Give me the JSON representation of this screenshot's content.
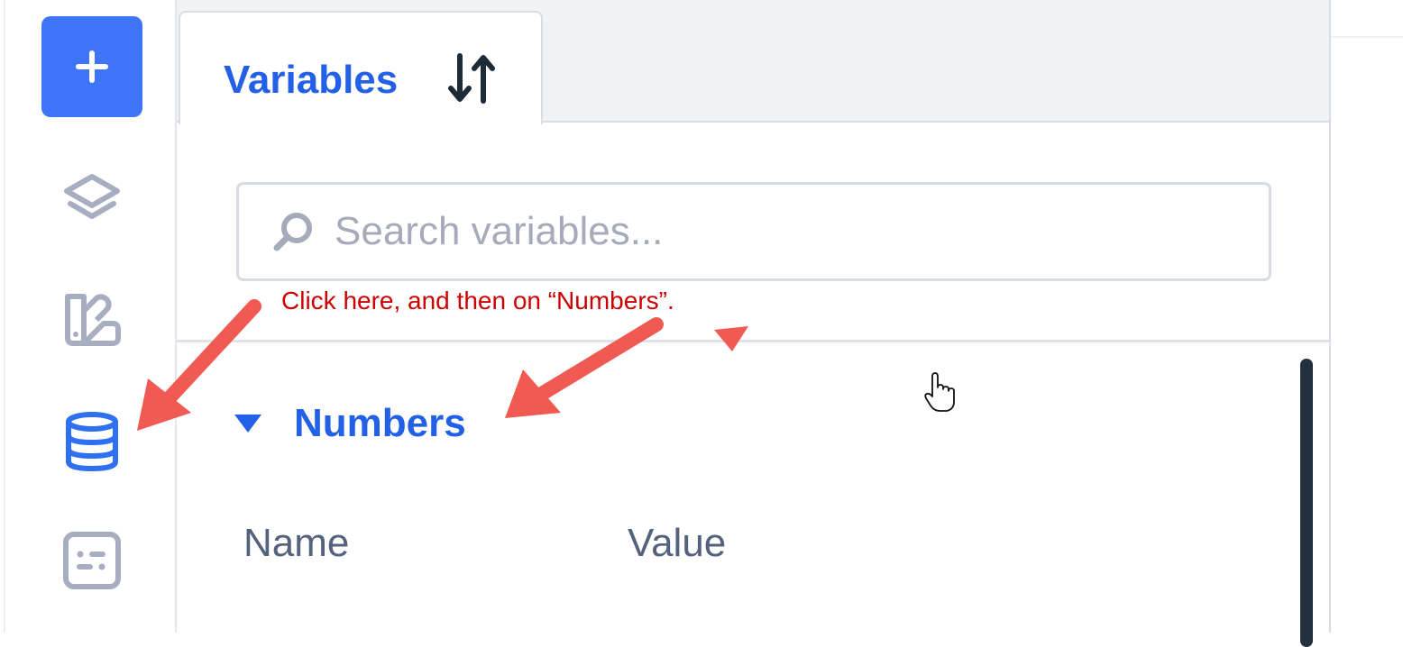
{
  "tabs": [
    {
      "label": "Variables",
      "active": true,
      "icon": "sort-icon"
    }
  ],
  "search": {
    "placeholder": "Search variables...",
    "value": "",
    "icon": "search-icon"
  },
  "group": {
    "label": "Numbers",
    "expanded": true,
    "icon": "caret-down-icon"
  },
  "table": {
    "columns": [
      "Name",
      "Value"
    ]
  },
  "sidebar": {
    "add_icon": "plus-icon",
    "items": [
      {
        "icon": "layers-icon",
        "active": false
      },
      {
        "icon": "paint-icon",
        "active": false
      },
      {
        "icon": "database-icon",
        "active": true
      },
      {
        "icon": "dialog-icon",
        "active": false
      }
    ]
  },
  "annotation": {
    "text": "Click here, and then on “Numbers”."
  },
  "colors": {
    "accent": "#3e75f7",
    "active_text": "#2360e8",
    "annotation": "#cc0000",
    "arrow": "#f05a52",
    "icon_inactive": "#a7aec1"
  }
}
